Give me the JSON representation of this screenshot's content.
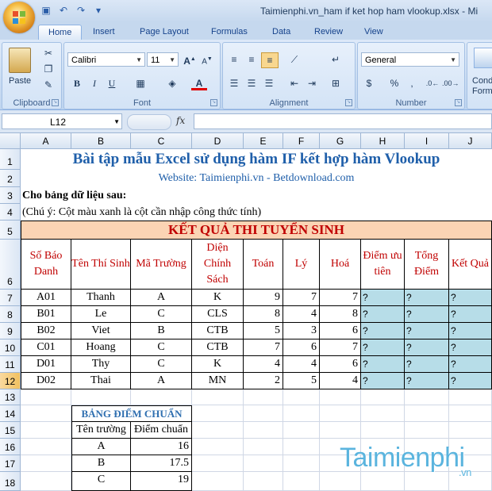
{
  "window": {
    "title": "Taimienphi.vn_ham if ket hop ham vlookup.xlsx - Mi"
  },
  "tabs": [
    "Home",
    "Insert",
    "Page Layout",
    "Formulas",
    "Data",
    "Review",
    "View"
  ],
  "ribbon": {
    "clipboard": {
      "label": "Clipboard",
      "paste": "Paste"
    },
    "font": {
      "label": "Font",
      "name": "Calibri",
      "size": "11",
      "bold": "B",
      "italic": "I",
      "underline": "U"
    },
    "alignment": {
      "label": "Alignment"
    },
    "number": {
      "label": "Number",
      "format": "General",
      "percent": "%"
    },
    "styles": {
      "cond": "Cond",
      "forma": "Forma"
    }
  },
  "formula_bar": {
    "name_box": "L12",
    "fx": "fx",
    "value": ""
  },
  "columns": [
    "A",
    "B",
    "C",
    "D",
    "E",
    "F",
    "G",
    "H",
    "I",
    "J"
  ],
  "rows": [
    "1",
    "2",
    "3",
    "4",
    "5",
    "6",
    "7",
    "8",
    "9",
    "10",
    "11",
    "12",
    "13",
    "14",
    "15",
    "16",
    "17",
    "18"
  ],
  "sheet": {
    "title": "Bài tập mẫu Excel sử dụng hàm IF kết hợp hàm Vlookup",
    "website": "Website: Taimienphi.vn - Betdownload.com",
    "given": "Cho bảng dữ liệu sau:",
    "note": "(Chú ý: Cột màu xanh là cột cần nhập công thức tính)",
    "result_title": "KẾT QUẢ THI TUYỂN SINH",
    "headers": [
      "Số Báo Danh",
      "Tên Thí Sinh",
      "Mã Trường",
      "Diện Chính Sách",
      "Toán",
      "Lý",
      "Hoá",
      "Điểm ưu tiên",
      "Tổng Điểm",
      "Kết Quả"
    ],
    "rows": [
      [
        "A01",
        "Thanh",
        "A",
        "K",
        "9",
        "7",
        "7",
        "?",
        "?",
        "?"
      ],
      [
        "B01",
        "Le",
        "C",
        "CLS",
        "8",
        "4",
        "8",
        "?",
        "?",
        "?"
      ],
      [
        "B02",
        "Viet",
        "B",
        "CTB",
        "5",
        "3",
        "6",
        "?",
        "?",
        "?"
      ],
      [
        "C01",
        "Hoang",
        "C",
        "CTB",
        "7",
        "6",
        "7",
        "?",
        "?",
        "?"
      ],
      [
        "D01",
        "Thy",
        "C",
        "K",
        "4",
        "4",
        "6",
        "?",
        "?",
        "?"
      ],
      [
        "D02",
        "Thai",
        "A",
        "MN",
        "2",
        "5",
        "4",
        "?",
        "?",
        "?"
      ]
    ],
    "standard_title": "BẢNG ĐIỂM CHUẨN",
    "standard_headers": [
      "Tên trường",
      "Điểm chuẩn"
    ],
    "standard_rows": [
      [
        "A",
        "16"
      ],
      [
        "B",
        "17.5"
      ],
      [
        "C",
        "19"
      ]
    ]
  },
  "watermark": {
    "brand": "Taimienphi",
    "suffix": ".vn"
  },
  "colors": {
    "teal": "#b7dde8",
    "peach": "#fbd4b4",
    "title_blue": "#1f5faa",
    "header_red": "#c00000"
  }
}
